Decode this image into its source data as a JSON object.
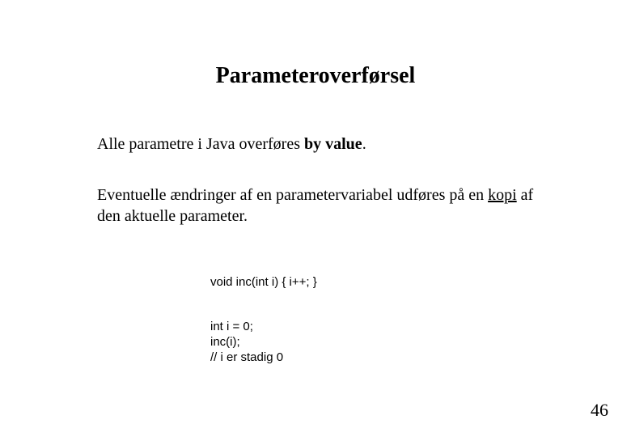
{
  "title": "Parameteroverførsel",
  "para1": {
    "pre": "Alle parametre i Java overføres ",
    "bold": "by value",
    "post": "."
  },
  "para2": {
    "pre": "Eventuelle ændringer af en parametervariabel udføres på en ",
    "underlined": "kopi",
    "post": " af den aktuelle parameter."
  },
  "code1": "void inc(int i) { i++; }",
  "code2": "int i = 0;\ninc(i);\n// i er stadig 0",
  "page_number": "46"
}
